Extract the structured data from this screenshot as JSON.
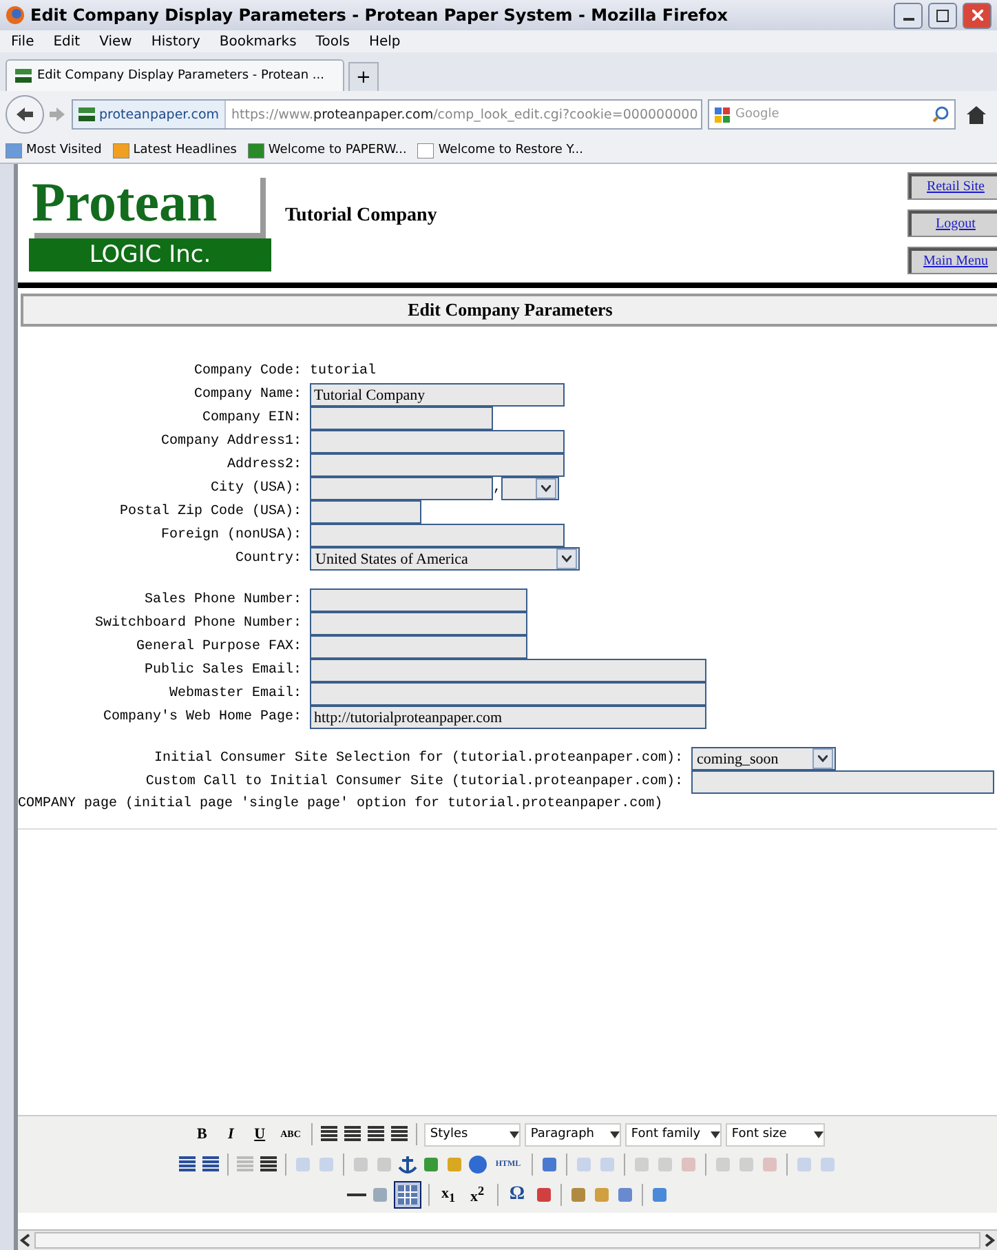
{
  "window": {
    "title": "Edit Company Display Parameters - Protean Paper System - Mozilla Firefox"
  },
  "menu": [
    "File",
    "Edit",
    "View",
    "History",
    "Bookmarks",
    "Tools",
    "Help"
  ],
  "tabs": [
    {
      "label": "Edit Company Display Parameters - Protean ...",
      "selected": true
    }
  ],
  "new_tab": "+",
  "address": {
    "site": "proteanpaper.com",
    "url_prefix": "https://www.",
    "url_domain": "proteanpaper.com",
    "url_rest": "/comp_look_edit.cgi?cookie=000000000"
  },
  "search": {
    "placeholder": "Google"
  },
  "bookmarks": [
    "Most Visited",
    "Latest Headlines",
    "Welcome to PAPERW...",
    "Welcome to Restore Y..."
  ],
  "header": {
    "logo_top": "Protean",
    "logo_bottom": "LOGIC Inc.",
    "company": "Tutorial Company",
    "links": [
      "Retail Site",
      "Logout",
      "Main Menu"
    ]
  },
  "panel_title": "Edit Company Parameters",
  "form": {
    "groups": [
      [
        {
          "kind": "text",
          "label": "Company Code:",
          "value": "tutorial"
        },
        {
          "kind": "input",
          "label": "Company Name:",
          "value": "Tutorial Company"
        },
        {
          "kind": "input",
          "label": "Company EIN:"
        },
        {
          "kind": "input",
          "label": "Company Address1:"
        },
        {
          "kind": "input",
          "label": "Address2:"
        },
        {
          "kind": "city",
          "label": "City (USA):",
          "separator": ","
        },
        {
          "kind": "input",
          "label": "Postal Zip Code (USA):"
        },
        {
          "kind": "input",
          "label": "Foreign (nonUSA):"
        },
        {
          "kind": "select",
          "label": "Country:",
          "value": "United States of America"
        }
      ],
      [
        {
          "kind": "input",
          "label": "Sales Phone Number:"
        },
        {
          "kind": "input",
          "label": "Switchboard Phone Number:"
        },
        {
          "kind": "input",
          "label": "General Purpose FAX:"
        },
        {
          "kind": "input",
          "label": "Public Sales Email:"
        },
        {
          "kind": "input",
          "label": "Webmaster Email:"
        },
        {
          "kind": "input",
          "label": "Company's Web Home Page:",
          "value": "http://tutorialproteanpaper.com"
        }
      ],
      [
        {
          "kind": "select",
          "label": "Initial Consumer Site Selection for (tutorial.proteanpaper.com):",
          "value": "coming_soon"
        },
        {
          "kind": "input",
          "label": "Custom Call to Initial Consumer Site (tutorial.proteanpaper.com):"
        }
      ]
    ]
  },
  "note": "COMPANY page (initial page 'single page' option for tutorial.proteanpaper.com)",
  "editor": {
    "format_buttons": [
      "B",
      "I",
      "U",
      "ABC"
    ],
    "selects": [
      "Styles",
      "Paragraph",
      "Font family",
      "Font size"
    ],
    "html_button": "HTML",
    "script_buttons": [
      "x$_{1}$",
      "x$^{2}$"
    ],
    "omega": "Ω"
  }
}
